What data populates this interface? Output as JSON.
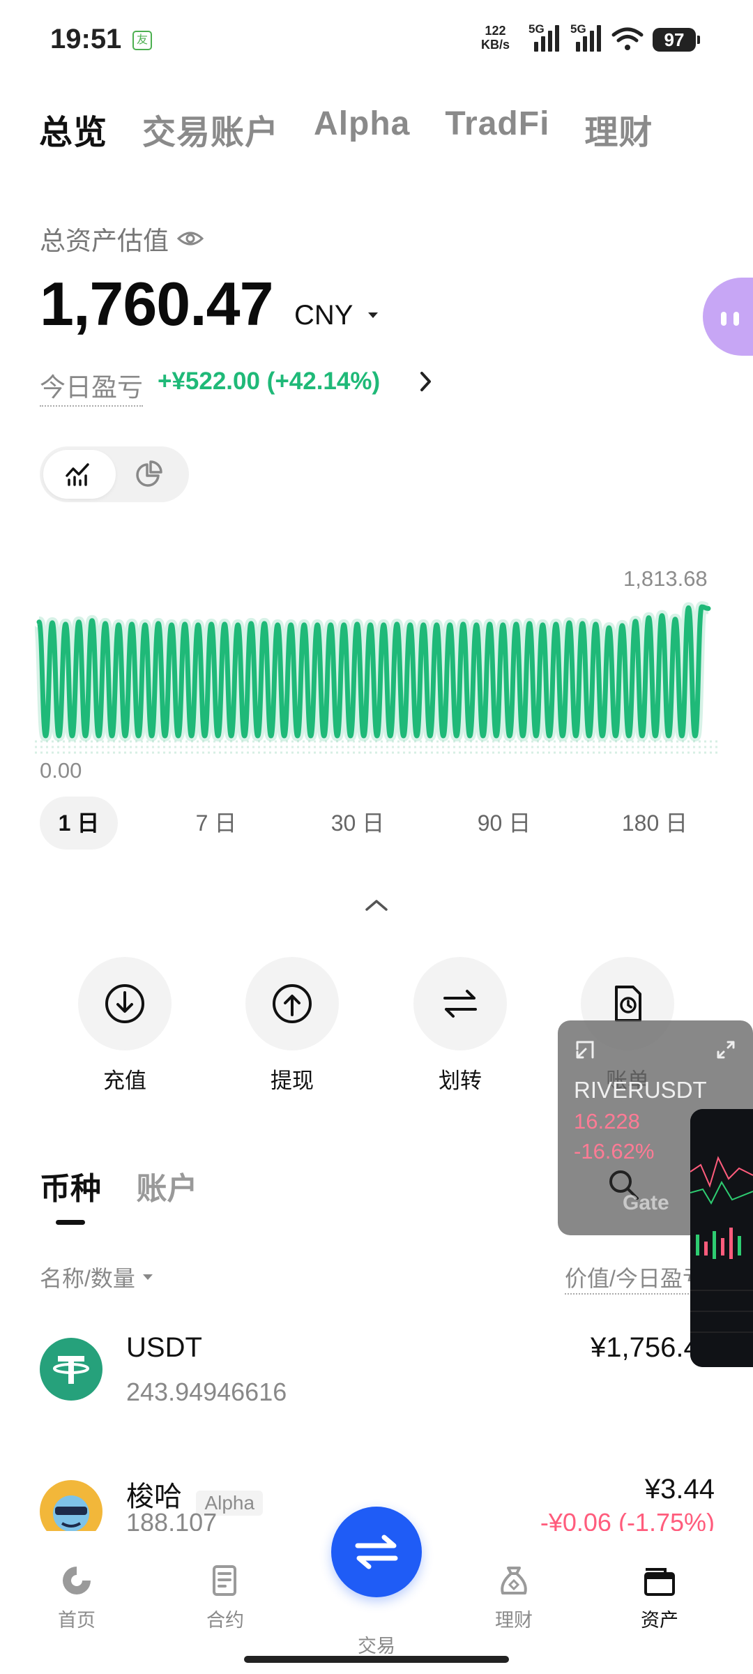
{
  "status_bar": {
    "time": "19:51",
    "app_glyph": "友",
    "net_speed_value": "122",
    "net_speed_unit": "KB/s",
    "sim1_label": "5G",
    "sim2_label": "5G",
    "battery": "97"
  },
  "top_tabs": [
    {
      "label": "总览",
      "active": true
    },
    {
      "label": "交易账户",
      "active": false
    },
    {
      "label": "Alpha",
      "active": false
    },
    {
      "label": "TradFi",
      "active": false
    },
    {
      "label": "理财",
      "active": false
    }
  ],
  "summary": {
    "asset_label": "总资产估值",
    "total_value": "1,760.47",
    "currency": "CNY",
    "pnl_label": "今日盈亏",
    "pnl_value": "+¥522.00 (+42.14%)"
  },
  "chart_data": {
    "type": "line",
    "max_label": "1,813.68",
    "min_label": "0.00",
    "ylim": [
      0,
      1813.68
    ],
    "values": [
      1600,
      0,
      1590,
      0,
      1570,
      0,
      1600,
      0,
      1620,
      0,
      1580,
      0,
      1560,
      0,
      1570,
      0,
      1560,
      0,
      1580,
      0,
      1560,
      0,
      1570,
      0,
      1560,
      0,
      1570,
      0,
      1570,
      0,
      1560,
      0,
      1580,
      0,
      1580,
      0,
      1560,
      0,
      1560,
      0,
      1560,
      0,
      1560,
      0,
      1560,
      0,
      1560,
      0,
      1570,
      0,
      1560,
      0,
      1560,
      0,
      1570,
      0,
      1560,
      0,
      1560,
      0,
      1560,
      0,
      1560,
      0,
      1570,
      0,
      1560,
      0,
      1570,
      0,
      1560,
      0,
      1570,
      0,
      1580,
      0,
      1560,
      0,
      1570,
      0,
      1590,
      0,
      1580,
      0,
      1570,
      0,
      1520,
      0,
      1550,
      0,
      1610,
      0,
      1660,
      0,
      1690,
      0,
      1640,
      0,
      1800,
      0,
      1813.68,
      1790
    ],
    "color": "#1fb978",
    "grid": false
  },
  "time_ranges": [
    {
      "label": "1 日",
      "active": true
    },
    {
      "label": "7 日",
      "active": false
    },
    {
      "label": "30 日",
      "active": false
    },
    {
      "label": "90 日",
      "active": false
    },
    {
      "label": "180 日",
      "active": false
    }
  ],
  "actions": [
    {
      "label": "充值",
      "icon": "deposit-icon"
    },
    {
      "label": "提现",
      "icon": "withdraw-icon"
    },
    {
      "label": "划转",
      "icon": "transfer-icon"
    },
    {
      "label": "账单",
      "icon": "bill-icon"
    }
  ],
  "section_tabs": [
    {
      "label": "币种",
      "active": true
    },
    {
      "label": "账户",
      "active": false
    }
  ],
  "list_header": {
    "left": "名称/数量",
    "right": "价值/今日盈亏"
  },
  "coins": [
    {
      "name": "USDT",
      "quantity": "243.94946616",
      "value": "¥1,756.43",
      "change": "",
      "badge": "",
      "icon_color": "#26a17b"
    },
    {
      "name": "梭哈",
      "quantity": "188,107",
      "value": "¥3.44",
      "change": "-¥0.06 (-1.75%)",
      "badge": "Alpha",
      "icon_color": "#f2b73a"
    }
  ],
  "floating_ticker": {
    "symbol": "RIVERUSDT",
    "price": "16.228",
    "change": "-16.62%",
    "brand": "Gate"
  },
  "bottom_nav": [
    {
      "label": "首页",
      "icon": "home-icon",
      "active": false
    },
    {
      "label": "合约",
      "icon": "contract-icon",
      "active": false
    },
    {
      "label": "交易",
      "icon": "trade-swap-icon",
      "active": false
    },
    {
      "label": "理财",
      "icon": "wealth-icon",
      "active": false
    },
    {
      "label": "资产",
      "icon": "wallet-icon",
      "active": true
    }
  ],
  "colors": {
    "accent_green": "#1fb978",
    "loss_red": "#ff5c7c",
    "trade_blue": "#1f5cf6"
  }
}
